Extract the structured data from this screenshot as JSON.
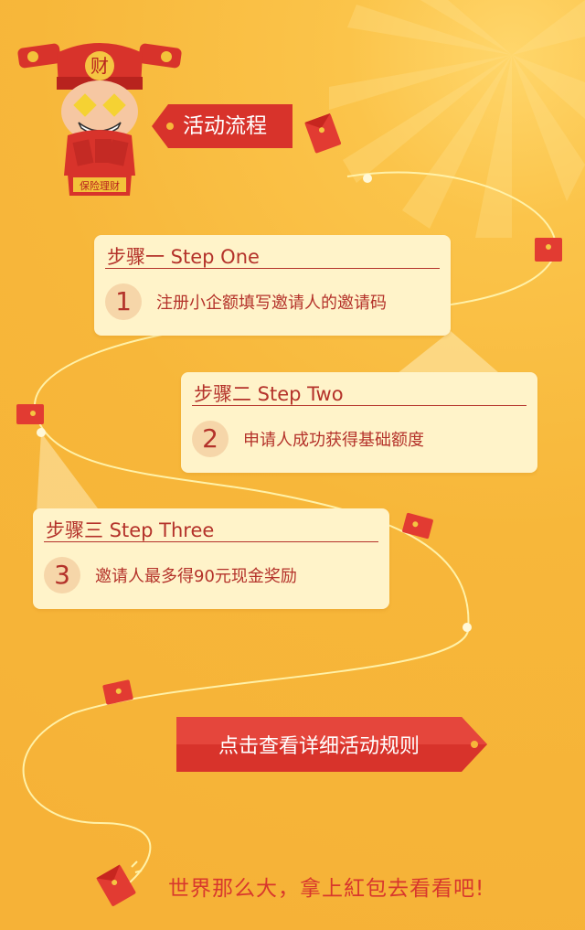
{
  "header": {
    "mascot_icon": "god-of-wealth-mascot-icon",
    "mascot_hat_char": "财",
    "mascot_banner_text": "保险理财",
    "section_title": "活动流程"
  },
  "steps": [
    {
      "title": "步骤一 Step One",
      "number": "1",
      "text": "注册小企额填写邀请人的邀请码"
    },
    {
      "title": "步骤二 Step Two",
      "number": "2",
      "text": "申请人成功获得基础额度"
    },
    {
      "title": "步骤三 Step Three",
      "number": "3",
      "text": "邀请人最多得90元现金奖励"
    }
  ],
  "cta": {
    "label": "点击查看详细活动规则"
  },
  "footer": {
    "slogan": "世界那么大，拿上紅包去看看吧!"
  },
  "decor": {
    "envelope_icon": "red-envelope-icon",
    "accent": "#e23b32",
    "background": "#f7b73a",
    "card_bg": "#fff3c9",
    "text_color": "#b4322a"
  }
}
